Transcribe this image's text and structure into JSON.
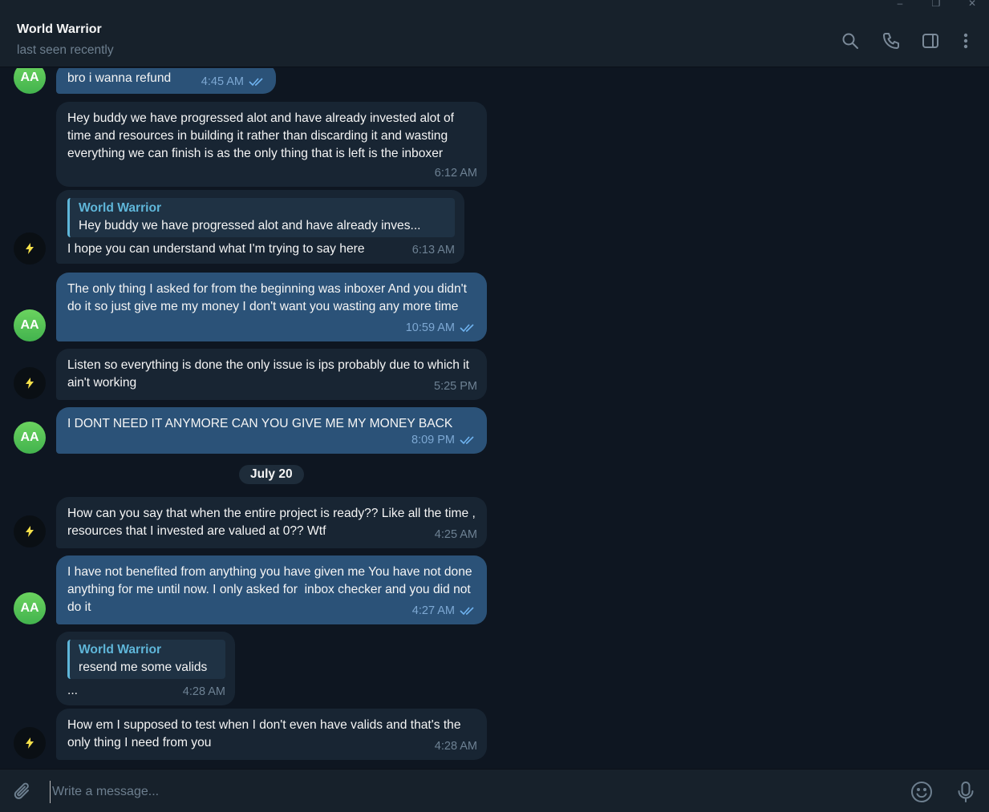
{
  "window": {
    "minimize_glyph": "–",
    "maximize_glyph": "❐",
    "close_glyph": "✕"
  },
  "header": {
    "title": "World Warrior",
    "status": "last seen recently",
    "icons": [
      "search-icon",
      "phone-icon",
      "sidebar-toggle-icon",
      "more-vertical-icon"
    ]
  },
  "avatars": {
    "self_initials": "AA",
    "self_color": "#4fbe51",
    "contact_icon": "lightning-bolt-icon",
    "contact_icon_color": "#f5e04a"
  },
  "messages": [
    {
      "id": "m1",
      "dir": "out",
      "text": "bro i wanna refund",
      "time": "4:45 AM",
      "read": true
    },
    {
      "id": "m2",
      "dir": "in",
      "text": "Hey buddy we have progressed alot and have already invested alot of time and resources in building it rather than discarding it and wasting everything we can finish is as the only thing that is left is the inboxer",
      "time": "6:12 AM"
    },
    {
      "id": "m3",
      "dir": "in",
      "reply_name": "World Warrior",
      "reply_text": "Hey buddy we have progressed alot and have already inves...",
      "text": "I hope you can understand what I'm trying to say here",
      "time": "6:13 AM"
    },
    {
      "id": "m4",
      "dir": "out",
      "text": "The only thing I asked for from the beginning was inboxer And you didn't do it so just give me my money I don't want you wasting any more time",
      "time": "10:59 AM",
      "read": true
    },
    {
      "id": "m5",
      "dir": "in",
      "text": "Listen so everything is done the only issue is ips probably due to which it ain't working",
      "time": "5:25 PM"
    },
    {
      "id": "m6",
      "dir": "out",
      "text": "I DONT NEED IT ANYMORE CAN YOU GIVE ME MY MONEY BACK",
      "time": "8:09 PM",
      "read": true
    },
    {
      "id": "m7",
      "dir": "in",
      "text": "How can you say that when the entire project is ready?? Like all the time , resources that I invested are valued at 0?? Wtf",
      "time": "4:25 AM"
    },
    {
      "id": "m8",
      "dir": "out",
      "text": "I have not benefited from anything you have given me You have not done anything for me until now. I only asked for  inbox checker and you did not do it",
      "time": "4:27 AM",
      "read": true
    },
    {
      "id": "m9",
      "dir": "in",
      "reply_name": "World Warrior",
      "reply_text": "resend me some valids",
      "text": "...",
      "time": "4:28 AM"
    },
    {
      "id": "m10",
      "dir": "in",
      "text": "How em I supposed to test when I don't even have valids and that's the only thing I need from you",
      "time": "4:28 AM"
    }
  ],
  "date_separator": "July 20",
  "composer": {
    "placeholder": "Write a message...",
    "value": "",
    "icons": [
      "paperclip-icon",
      "emoji-icon",
      "microphone-icon"
    ]
  }
}
